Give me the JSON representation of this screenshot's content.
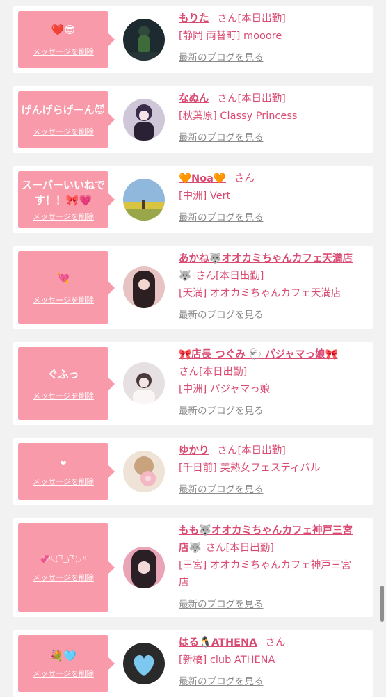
{
  "cards": [
    {
      "message": "❤️😎",
      "delete_label": "メッセージを削除",
      "name": "もりた",
      "san": "さん[本日出勤]",
      "shop": "[静岡 両替町] mooore",
      "blog_label": "最新のブログを見る",
      "avatar_colors": [
        "#1d2a2f",
        "#3f6b3a"
      ]
    },
    {
      "message": "げんげらげーん😈",
      "delete_label": "メッセージを削除",
      "name": "なぬん",
      "san": "さん[本日出勤]",
      "shop": "[秋葉原] Classy Princess",
      "blog_label": "最新のブログを見る",
      "avatar_colors": [
        "#cfc7d8",
        "#3a2b48"
      ]
    },
    {
      "message": "スーパーいいねです！！🎀💗",
      "delete_label": "メッセージを削除",
      "name": "🧡Noa🧡",
      "san": "さん",
      "shop": "[中洲] Vert",
      "blog_label": "最新のブログを見る",
      "avatar_colors": [
        "#8fb8dc",
        "#d8c440"
      ]
    },
    {
      "message": "💘",
      "delete_label": "メッセージを削除",
      "name": "あかね🐺オオカミちゃんカフェ天満店",
      "name_cont": "🐺",
      "san": "さん[本日出勤]",
      "shop": "[天満] オオカミちゃんカフェ天満店",
      "blog_label": "最新のブログを見る",
      "avatar_colors": [
        "#e7c3c3",
        "#2b1f22"
      ]
    },
    {
      "message": "ぐふっ",
      "delete_label": "メッセージを削除",
      "name": "🎀店長 つぐみ 🐑 パジャマっ娘🎀",
      "san": "さん[本日出勤]",
      "shop": "[中洲] パジャマっ娘",
      "blog_label": "最新のブログを見る",
      "avatar_colors": [
        "#e6e0e2",
        "#4a3a40"
      ]
    },
    {
      "message": "❤",
      "delete_label": "メッセージを削除",
      "name": "ゆかり",
      "san": "さん[本日出勤]",
      "shop": "[千日前] 美熟女フェスティバル",
      "blog_label": "最新のブログを見る",
      "avatar_colors": [
        "#efe2d6",
        "#f3b8c4"
      ]
    },
    {
      "message": "💞⁽⁽◟(  ͡° ͜ʖ ͡°)◞ ⁾⁾",
      "delete_label": "メッセージを削除",
      "name": "もも🐺オオカミちゃんカフェ神戸三宮",
      "name_cont": "店🐺",
      "san": "さん[本日出勤]",
      "shop": "[三宮] オオカミちゃんカフェ神戸三宮",
      "shop_cont": "店",
      "blog_label": "最新のブログを見る",
      "avatar_colors": [
        "#2a1f24",
        "#e9a4b6"
      ]
    },
    {
      "message": "💐🩵",
      "delete_label": "メッセージを削除",
      "name": "はる🐧ATHENA",
      "san": "さん",
      "shop": "[新橋] club ATHENA",
      "blog_label": "最新のブログを見る",
      "avatar_colors": [
        "#2a2a2a",
        "#7cc8f0"
      ]
    }
  ]
}
